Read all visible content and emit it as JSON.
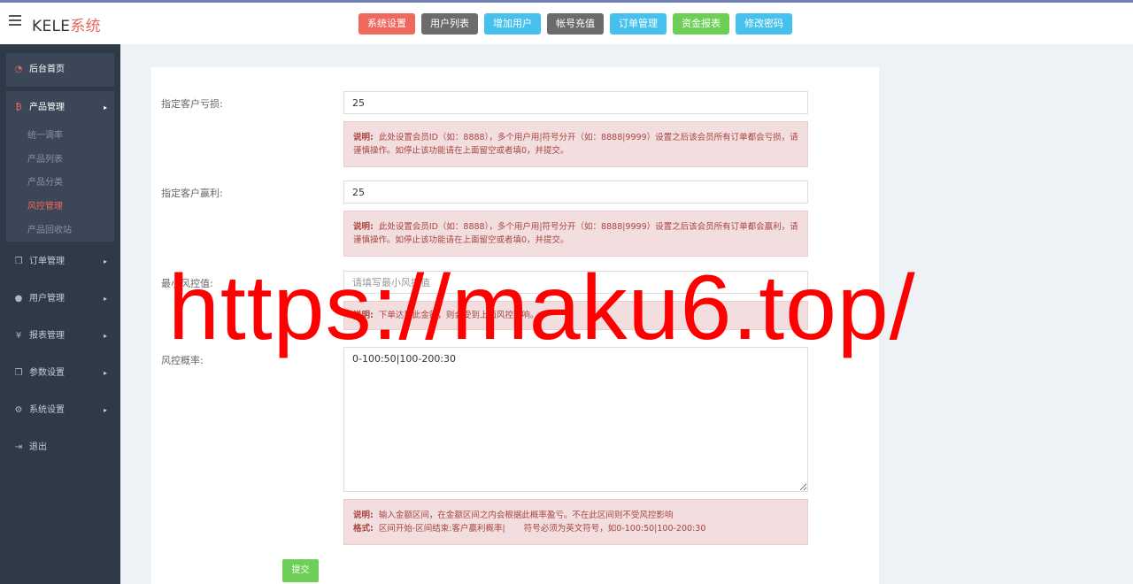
{
  "brand": {
    "prefix": "KELE",
    "suffix": "系统"
  },
  "topnav": [
    {
      "label": "系统设置",
      "color": "#f0675e"
    },
    {
      "label": "用户列表",
      "color": "#6b6b6b"
    },
    {
      "label": "增加用户",
      "color": "#46c1ee"
    },
    {
      "label": "帐号充值",
      "color": "#6b6b6b"
    },
    {
      "label": "订单管理",
      "color": "#46c1ee"
    },
    {
      "label": "资金报表",
      "color": "#6dcf55"
    },
    {
      "label": "修改密码",
      "color": "#46c1ee"
    }
  ],
  "sidebar": {
    "home": "后台首页",
    "product": {
      "label": "产品管理",
      "sub": [
        "统一调率",
        "产品列表",
        "产品分类",
        "风控管理",
        "产品回收站"
      ],
      "active_index": 3
    },
    "items": [
      "订单管理",
      "用户管理",
      "报表管理",
      "参数设置",
      "系统设置",
      "退出"
    ]
  },
  "form": {
    "loss_label": "指定客户亏损:",
    "loss_value": "25",
    "loss_note_title": "说明:",
    "loss_note_text": "此处设置会员ID（如：8888），多个用户用|符号分开（如：8888|9999）设置之后该会员所有订单都会亏损，请谨慎操作。如停止该功能请在上面留空或者填0，并提交。",
    "profit_label": "指定客户赢利:",
    "profit_value": "25",
    "profit_note_title": "说明:",
    "profit_note_text": "此处设置会员ID（如：8888），多个用户用|符号分开（如：8888|9999）设置之后该会员所有订单都会赢利，请谨慎操作。如停止该功能请在上面留空或者填0，并提交。",
    "min_label": "最小风控值:",
    "min_placeholder": "请填写最小风控值",
    "min_note_title": "说明:",
    "min_note_text": "下单达到此金额，则会受到上面风控影响。",
    "prob_label": "风控概率:",
    "prob_value": "0-100:50|100-200:30",
    "prob_note_title": "说明:",
    "prob_note_text": "输入金额区间，在金额区间之内会根据此概率盈亏。不在此区间则不受风控影响",
    "prob_format_title": "格式:",
    "prob_format_text": "区间开始-区间结束:客户赢利概率|       符号必须为英文符号，如0-100:50|100-200:30",
    "submit": "提交"
  },
  "watermark": "https://maku6.top/"
}
